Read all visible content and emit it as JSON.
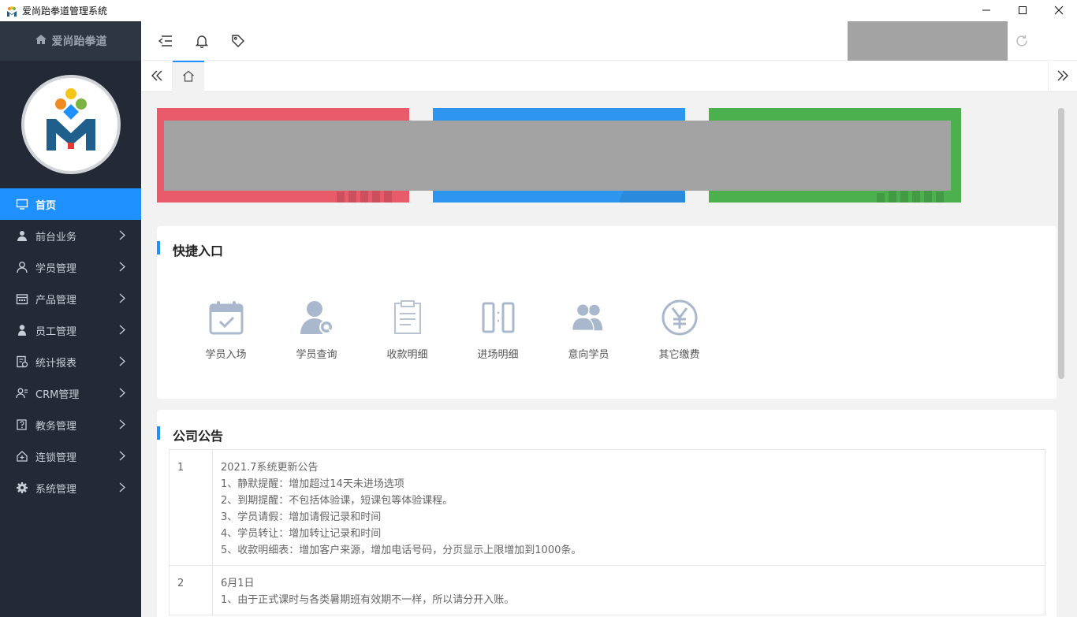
{
  "window": {
    "title": "爱尚跆拳道管理系统",
    "icons": {
      "app": "app-logo-icon",
      "minimize": "minimize-icon",
      "maximize": "maximize-icon",
      "close": "close-icon"
    }
  },
  "sidebar": {
    "brand": "爱尚跆拳道",
    "brand_icon": "home-icon",
    "items": [
      {
        "label": "首页",
        "icon": "monitor-icon",
        "active": true
      },
      {
        "label": "前台业务",
        "icon": "reception-icon"
      },
      {
        "label": "学员管理",
        "icon": "user-icon"
      },
      {
        "label": "产品管理",
        "icon": "calendar-icon"
      },
      {
        "label": "员工管理",
        "icon": "staff-icon"
      },
      {
        "label": "统计报表",
        "icon": "report-icon"
      },
      {
        "label": "CRM管理",
        "icon": "crm-icon"
      },
      {
        "label": "教务管理",
        "icon": "edit-doc-icon"
      },
      {
        "label": "连锁管理",
        "icon": "chain-home-icon"
      },
      {
        "label": "系统管理",
        "icon": "gear-icon"
      }
    ]
  },
  "header": {
    "icons": [
      "menu-fold-icon",
      "bell-icon",
      "tag-icon",
      "refresh-icon"
    ]
  },
  "tabs": {
    "icons": [
      "double-left-icon",
      "home-tab-icon",
      "double-right-icon"
    ]
  },
  "stat_cards": {
    "colors": [
      "#e95a6a",
      "#2e96ef",
      "#4db04f"
    ]
  },
  "quick": {
    "title": "快捷入口",
    "items": [
      {
        "label": "学员入场",
        "icon": "check-in-icon"
      },
      {
        "label": "学员查询",
        "icon": "user-search-icon"
      },
      {
        "label": "收款明细",
        "icon": "clipboard-icon"
      },
      {
        "label": "进场明细",
        "icon": "door-icon"
      },
      {
        "label": "意向学员",
        "icon": "users-icon"
      },
      {
        "label": "其它缴费",
        "icon": "yen-icon"
      }
    ]
  },
  "notice": {
    "title": "公司公告",
    "rows": [
      {
        "num": "1",
        "lines": [
          "2021.7系统更新公告",
          "1、静默提醒：增加超过14天未进场选项",
          "2、到期提醒：不包括体验课，短课包等体验课程。",
          "3、学员请假：增加请假记录和时间",
          "4、学员转让：增加转让记录和时间",
          "5、收款明细表：增加客户来源，增加电话号码，分页显示上限增加到1000条。"
        ]
      },
      {
        "num": "2",
        "lines": [
          "6月1日",
          "1、由于正式课时与各类暑期班有效期不一样，所以请分开入账。"
        ]
      }
    ]
  },
  "accent_color": "#1e90ff"
}
